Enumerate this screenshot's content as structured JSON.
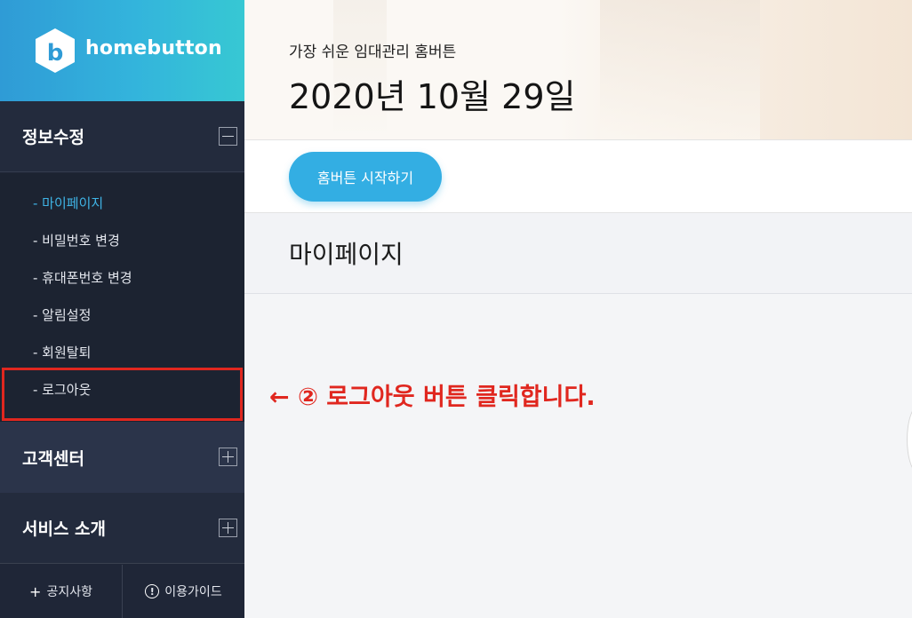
{
  "brand": {
    "logo_letter": "b",
    "name": "homebutton"
  },
  "sidebar": {
    "sections": [
      {
        "label": "정보수정",
        "state": "expanded"
      },
      {
        "label": "고객센터",
        "state": "collapsed"
      },
      {
        "label": "서비스 소개",
        "state": "collapsed"
      }
    ],
    "submenu": [
      {
        "label": "- 마이페이지",
        "active": true
      },
      {
        "label": "- 비밀번호 변경"
      },
      {
        "label": "- 휴대폰번호 변경"
      },
      {
        "label": "- 알림설정"
      },
      {
        "label": "- 회원탈퇴"
      },
      {
        "label": "- 로그아웃"
      }
    ],
    "footer": {
      "notice_icon": "+",
      "notice_label": "공지사항",
      "guide_icon": "!",
      "guide_label": "이용가이드"
    }
  },
  "hero": {
    "subtitle": "가장 쉬운 임대관리 홈버튼",
    "date": "2020년 10월 29일"
  },
  "start_button": "홈버튼 시작하기",
  "page_title": "마이페이지",
  "annotation": "← ② 로그아웃 버튼 클릭합니다.",
  "colors": {
    "accent": "#33aee3",
    "sidebar_bg": "#1f2637",
    "highlight": "#e0271f"
  }
}
